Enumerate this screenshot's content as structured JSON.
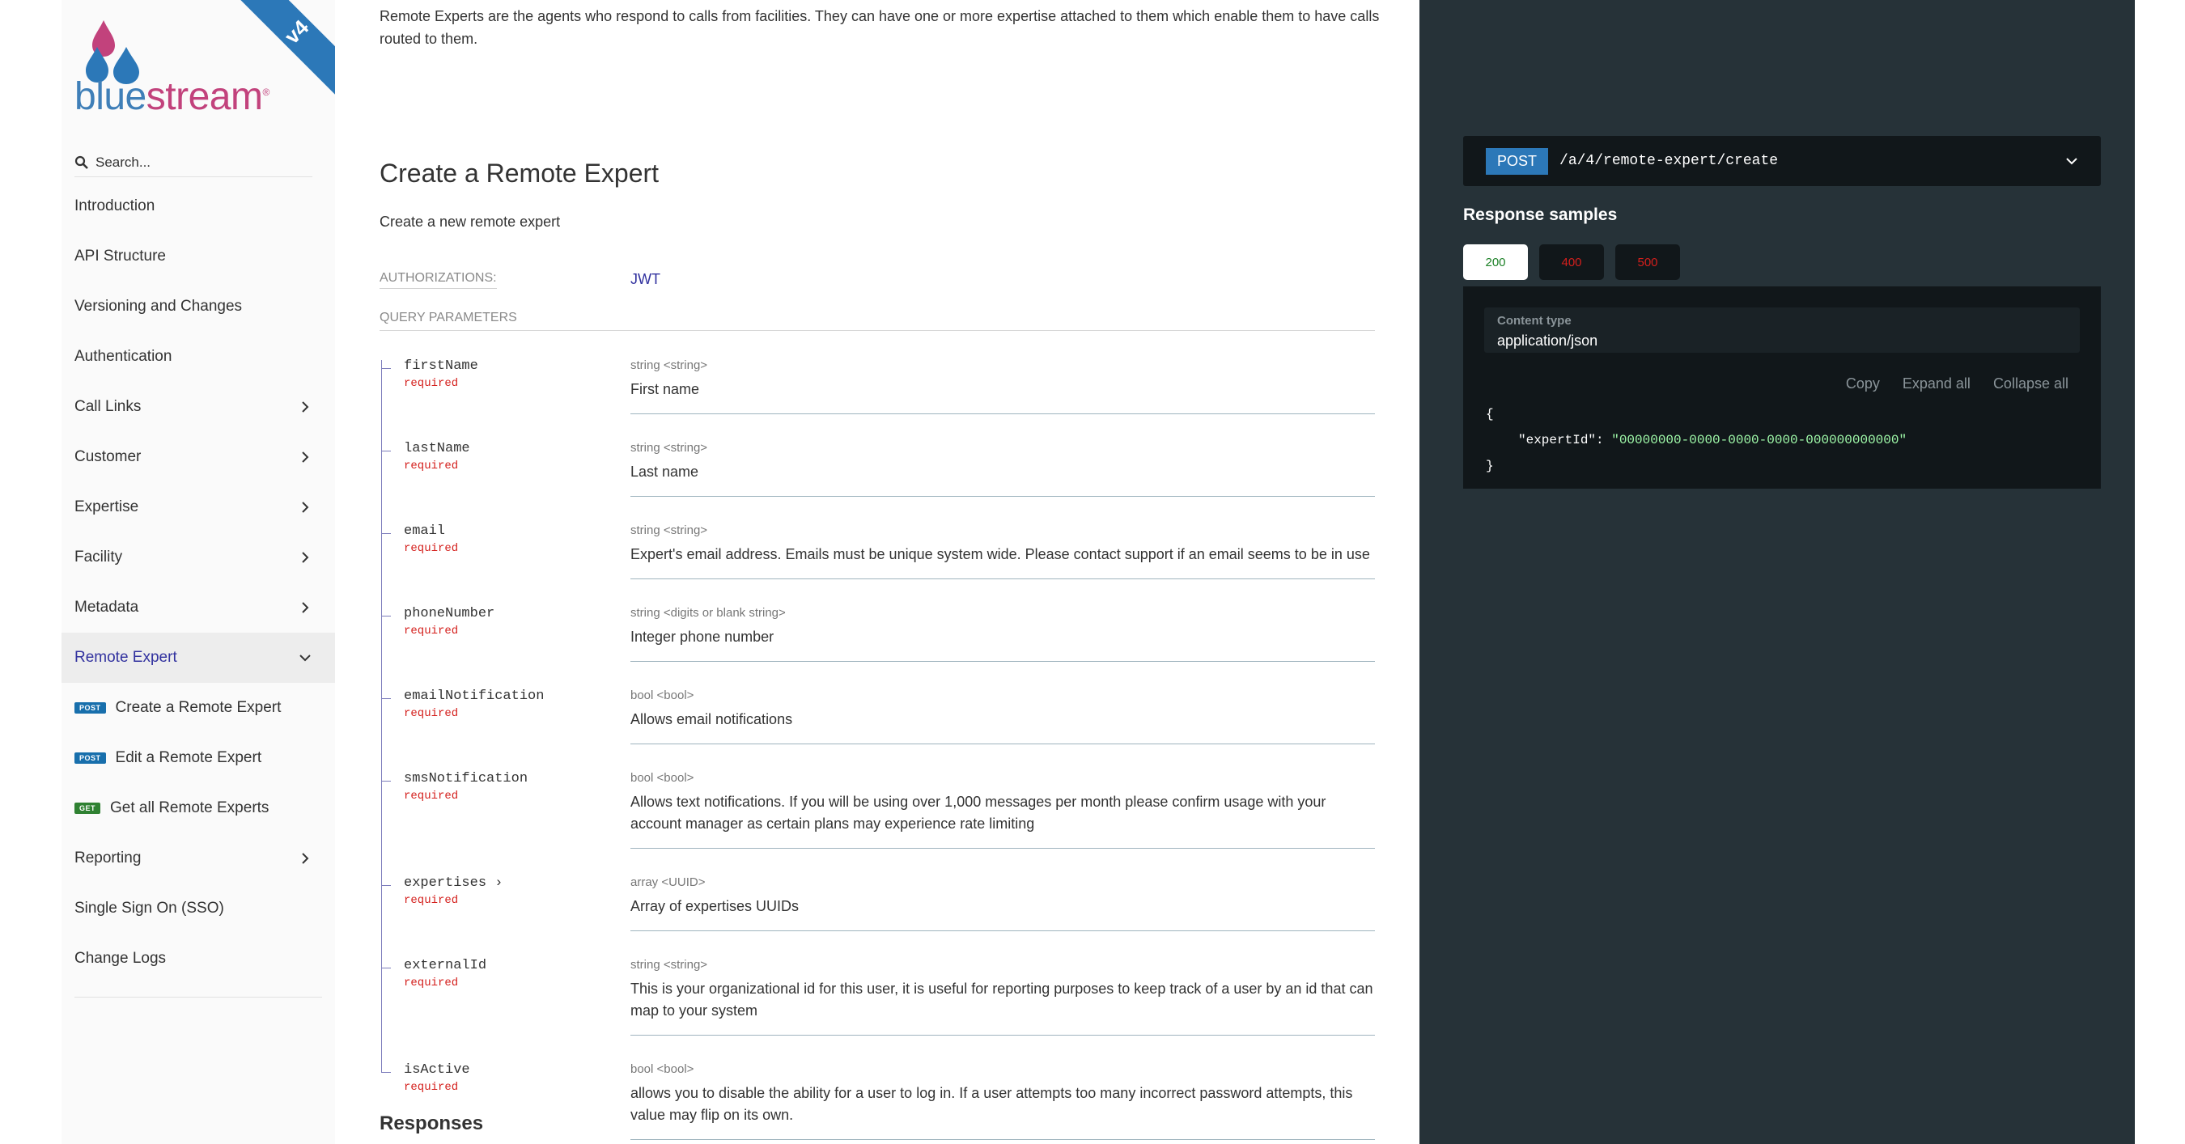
{
  "sidebar": {
    "brand": {
      "part1": "blue",
      "part2": "stream",
      "mark": "®",
      "version": "v4"
    },
    "search": {
      "placeholder": "Search..."
    },
    "items": [
      {
        "label": "Introduction",
        "has_chevron": false
      },
      {
        "label": "API Structure",
        "has_chevron": false
      },
      {
        "label": "Versioning and Changes",
        "has_chevron": false
      },
      {
        "label": "Authentication",
        "has_chevron": false
      },
      {
        "label": "Call Links",
        "has_chevron": true
      },
      {
        "label": "Customer",
        "has_chevron": true
      },
      {
        "label": "Expertise",
        "has_chevron": true
      },
      {
        "label": "Facility",
        "has_chevron": true
      },
      {
        "label": "Metadata",
        "has_chevron": true
      },
      {
        "label": "Remote Expert",
        "has_chevron": true,
        "active": true
      }
    ],
    "sub_items": [
      {
        "method": "POST",
        "label": "Create a Remote Expert"
      },
      {
        "method": "POST",
        "label": "Edit a Remote Expert"
      },
      {
        "method": "GET",
        "label": "Get all Remote Experts"
      }
    ],
    "items_after": [
      {
        "label": "Reporting",
        "has_chevron": true
      },
      {
        "label": "Single Sign On (SSO)",
        "has_chevron": false
      },
      {
        "label": "Change Logs",
        "has_chevron": false
      }
    ]
  },
  "main": {
    "intro": "Remote Experts are the agents who respond to calls from facilities. They can have one or more expertise attached to them which enable them to have calls routed to them.",
    "title": "Create a Remote Expert",
    "description": "Create a new remote expert",
    "authorizations_label": "AUTHORIZATIONS:",
    "authorizations_value": "JWT",
    "query_params_label": "QUERY PARAMETERS",
    "params": [
      {
        "name": "firstName",
        "required": "required",
        "type": "string <string>",
        "desc": "First name"
      },
      {
        "name": "lastName",
        "required": "required",
        "type": "string <string>",
        "desc": "Last name"
      },
      {
        "name": "email",
        "required": "required",
        "type": "string <string>",
        "desc": "Expert's email address. Emails must be unique system wide. Please contact support if an email seems to be in use"
      },
      {
        "name": "phoneNumber",
        "required": "required",
        "type": "string <digits or blank string>",
        "desc": "Integer phone number"
      },
      {
        "name": "emailNotification",
        "required": "required",
        "type": "bool <bool>",
        "desc": "Allows email notifications"
      },
      {
        "name": "smsNotification",
        "required": "required",
        "type": "bool <bool>",
        "desc": "Allows text notifications. If you will be using over 1,000 messages per month please confirm usage with your account manager as certain plans may experience rate limiting"
      },
      {
        "name": "expertises ›",
        "required": "required",
        "type": "array <UUID>",
        "desc": "Array of expertises UUIDs"
      },
      {
        "name": "externalId",
        "required": "required",
        "type": "string <string>",
        "desc": "This is your organizational id for this user, it is useful for reporting purposes to keep track of a user by an id that can map to your system"
      },
      {
        "name": "isActive",
        "required": "required",
        "type": "bool <bool>",
        "desc": "allows you to disable the ability for a user to log in. If a user attempts too many incorrect password attempts, this value may flip on its own."
      }
    ],
    "responses_heading": "Responses"
  },
  "right": {
    "method": "POST",
    "path": "/a/4/remote-expert/create",
    "response_samples_title": "Response samples",
    "tabs": [
      "200",
      "400",
      "500"
    ],
    "content_type_label": "Content type",
    "content_type_value": "application/json",
    "actions": [
      "Copy",
      "Expand all",
      "Collapse all"
    ],
    "code": {
      "open": "{",
      "key": "\"expertId\"",
      "colon": ": ",
      "value": "\"00000000-0000-0000-0000-000000000000\"",
      "close": "}"
    }
  },
  "colors": {
    "accent": "#32329f",
    "post_badge": "#186fac",
    "get_badge": "#2f8132",
    "required": "#d41f1c",
    "right_panel": "#263238",
    "success": "#1d8127"
  }
}
